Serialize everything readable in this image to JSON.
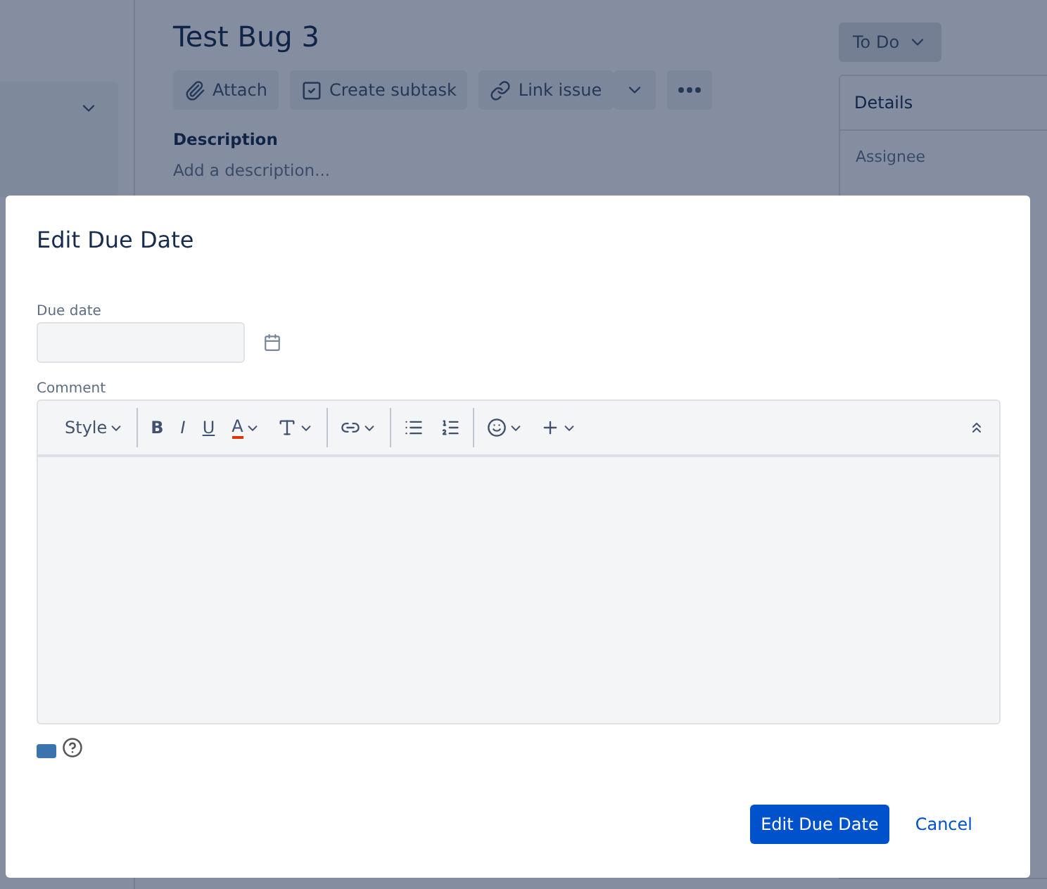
{
  "issue": {
    "title": "Test Bug 3",
    "actions": [
      {
        "kind": "attach",
        "label": "Attach"
      },
      {
        "kind": "subtask",
        "label": "Create subtask"
      },
      {
        "kind": "link",
        "label": "Link issue"
      }
    ],
    "description": {
      "label": "Description",
      "placeholder": "Add a description..."
    },
    "status": "To Do",
    "details": {
      "title": "Details",
      "fields": [
        {
          "label": "Assignee"
        }
      ]
    }
  },
  "dialog": {
    "title": "Edit Due Date",
    "due_date": {
      "label": "Due date"
    },
    "comment": {
      "label": "Comment",
      "toolbar_groups": [
        [
          {
            "kind": "style",
            "label": "Style",
            "menu": true
          }
        ],
        [
          {
            "kind": "bold",
            "label": "B",
            "menu": false
          },
          {
            "kind": "italic",
            "label": "I",
            "menu": false
          },
          {
            "kind": "underline",
            "label": "U",
            "menu": false
          },
          {
            "kind": "color",
            "label": "A",
            "menu": true
          },
          {
            "kind": "size",
            "menu": true
          }
        ],
        [
          {
            "kind": "link",
            "menu": true
          }
        ],
        [
          {
            "kind": "bullets",
            "menu": false
          },
          {
            "kind": "numbers",
            "menu": false
          }
        ],
        [
          {
            "kind": "emoji",
            "menu": true
          },
          {
            "kind": "insert",
            "menu": true
          }
        ]
      ]
    },
    "buttons": [
      {
        "label": "Edit Due Date",
        "primary": true
      },
      {
        "label": "Cancel",
        "primary": false
      }
    ]
  }
}
